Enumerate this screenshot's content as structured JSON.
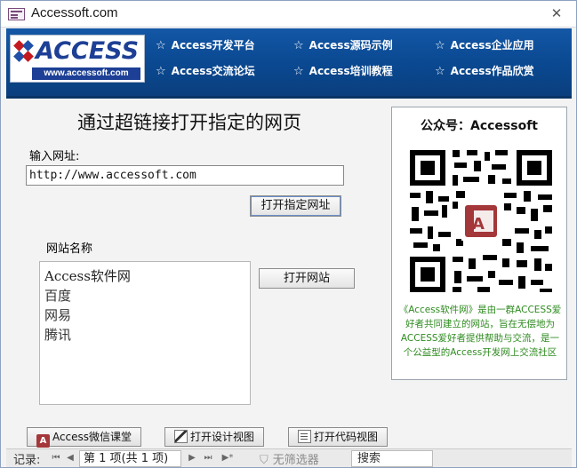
{
  "window": {
    "title": "Accessoft.com",
    "close_glyph": "✕"
  },
  "header": {
    "logo_word": "ACCESS",
    "logo_url": "www.accessoft.com",
    "nav": [
      {
        "label": "Access开发平台",
        "icon": "star-icon"
      },
      {
        "label": "Access源码示例",
        "icon": "star-icon"
      },
      {
        "label": "Access企业应用",
        "icon": "star-icon"
      },
      {
        "label": "Access交流论坛",
        "icon": "star-icon"
      },
      {
        "label": "Access培训教程",
        "icon": "star-icon"
      },
      {
        "label": "Access作品欣赏",
        "icon": "star-icon"
      }
    ]
  },
  "form": {
    "title": "通过超链接打开指定的网页",
    "url_label": "输入网址:",
    "url_value": "http://www.accessoft.com",
    "open_url_button": "打开指定网址",
    "site_list_label": "网站名称",
    "sites": [
      "Access软件网",
      "百度",
      "网易",
      "腾讯"
    ],
    "open_site_button": "打开网站"
  },
  "qr_panel": {
    "title": "公众号：Accessoft",
    "caption": "《Access软件网》是由一群ACCESS爱好者共同建立的网站，旨在无偿地为ACCESS爱好者提供帮助与交流，是一个公益型的Access开发网上交流社区"
  },
  "bottom_buttons": {
    "weixin": "Access微信课堂",
    "design_view": "打开设计视图",
    "code_view": "打开代码视图"
  },
  "record_nav": {
    "label": "记录:",
    "record": "第 1 项(共 1 项)",
    "filter": "无筛选器",
    "search": "搜索"
  },
  "colors": {
    "header_blue": "#0a4890",
    "caption_green": "#2e8b1f",
    "logo_blue": "#1d3f95",
    "logo_red": "#c4191f"
  }
}
